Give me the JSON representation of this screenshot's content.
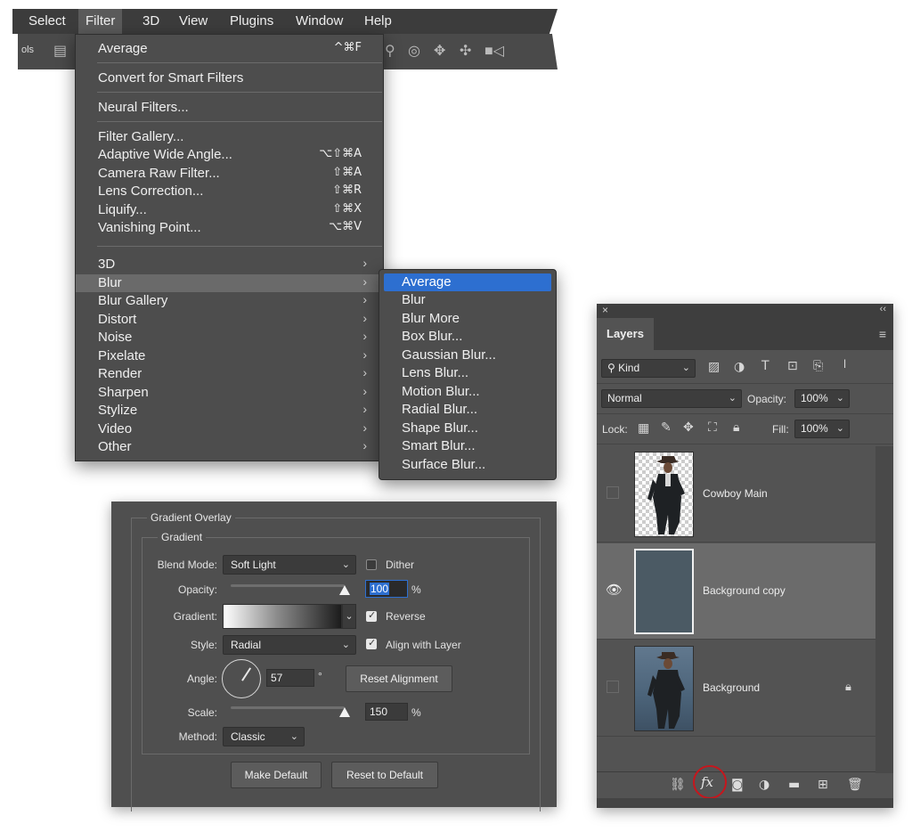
{
  "menubar": {
    "items": [
      "Select",
      "Filter",
      "3D",
      "View",
      "Plugins",
      "Window",
      "Help"
    ],
    "active": "Filter",
    "options_label": "ols"
  },
  "filter_menu": {
    "top": [
      {
        "label": "Average",
        "shortcut": "^⌘F"
      },
      {
        "label": "Convert for Smart Filters",
        "shortcut": ""
      },
      {
        "label": "Neural Filters...",
        "shortcut": ""
      }
    ],
    "special": [
      {
        "label": "Filter Gallery...",
        "shortcut": ""
      },
      {
        "label": "Adaptive Wide Angle...",
        "shortcut": "⌥⇧⌘A"
      },
      {
        "label": "Camera Raw Filter...",
        "shortcut": "⇧⌘A"
      },
      {
        "label": "Lens Correction...",
        "shortcut": "⇧⌘R"
      },
      {
        "label": "Liquify...",
        "shortcut": "⇧⌘X"
      },
      {
        "label": "Vanishing Point...",
        "shortcut": "⌥⌘V"
      }
    ],
    "submenus": [
      "3D",
      "Blur",
      "Blur Gallery",
      "Distort",
      "Noise",
      "Pixelate",
      "Render",
      "Sharpen",
      "Stylize",
      "Video",
      "Other"
    ],
    "highlighted": "Blur"
  },
  "blur_submenu": {
    "items": [
      "Average",
      "Blur",
      "Blur More",
      "Box Blur...",
      "Gaussian Blur...",
      "Lens Blur...",
      "Motion Blur...",
      "Radial Blur...",
      "Shape Blur...",
      "Smart Blur...",
      "Surface Blur..."
    ],
    "selected": "Average"
  },
  "gradient_overlay": {
    "title": "Gradient Overlay",
    "group": "Gradient",
    "blend_mode_label": "Blend Mode:",
    "blend_mode": "Soft Light",
    "dither_label": "Dither",
    "dither": false,
    "opacity_label": "Opacity:",
    "opacity": "100",
    "opacity_unit": "%",
    "opacity_level": 1.0,
    "gradient_label": "Gradient:",
    "reverse_label": "Reverse",
    "reverse": true,
    "style_label": "Style:",
    "style": "Radial",
    "align_label": "Align with Layer",
    "align": true,
    "angle_label": "Angle:",
    "angle": "57",
    "angle_unit": "°",
    "reset_alignment": "Reset Alignment",
    "scale_label": "Scale:",
    "scale": "150",
    "scale_unit": "%",
    "scale_level": 1.0,
    "method_label": "Method:",
    "method": "Classic",
    "make_default": "Make Default",
    "reset_default": "Reset to Default"
  },
  "layers_panel": {
    "tab": "Layers",
    "filter_kind": "Kind",
    "blend_mode": "Normal",
    "opacity_label": "Opacity:",
    "opacity": "100%",
    "lock_label": "Lock:",
    "fill_label": "Fill:",
    "fill": "100%",
    "layers": [
      {
        "name": "Cowboy Main",
        "visible": false,
        "selected": false,
        "locked": false
      },
      {
        "name": "Background copy",
        "visible": true,
        "selected": true,
        "locked": false
      },
      {
        "name": "Background",
        "visible": false,
        "selected": false,
        "locked": true
      }
    ]
  },
  "colors": {
    "menu_bg": "#4d4d4d",
    "selection_blue": "#2d6fd0",
    "highlight_ring": "#c6161d"
  }
}
